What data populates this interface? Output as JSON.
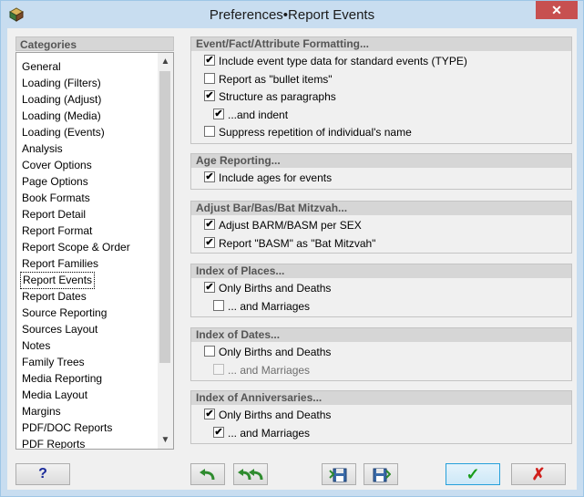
{
  "window": {
    "title": "Preferences•Report Events",
    "close_glyph": "✕"
  },
  "categories": {
    "header": "Categories",
    "items": [
      "General",
      "Loading (Filters)",
      "Loading (Adjust)",
      "Loading (Media)",
      "Loading (Events)",
      "Analysis",
      "Cover Options",
      "Page Options",
      "Book Formats",
      "Report Detail",
      "Report Format",
      "Report Scope & Order",
      "Report Families",
      "Report Events",
      "Report Dates",
      "Source Reporting",
      "Sources Layout",
      "Notes",
      "Family Trees",
      "Media Reporting",
      "Media Layout",
      "Margins",
      "PDF/DOC Reports",
      "PDF Reports"
    ],
    "selected": "Report Events",
    "scroll_up": "▲",
    "scroll_down": "▼"
  },
  "sections": {
    "formatting": {
      "header": "Event/Fact/Attribute Formatting...",
      "options": [
        {
          "label": "Include event type data for standard events (TYPE)",
          "checked": true
        },
        {
          "label": "Report as \"bullet items\"",
          "checked": false
        },
        {
          "label": "Structure as paragraphs",
          "checked": true
        },
        {
          "label": "...and indent",
          "checked": true
        },
        {
          "label": "Suppress repetition of individual's name",
          "checked": false
        }
      ]
    },
    "age": {
      "header": "Age Reporting...",
      "options": [
        {
          "label": "Include ages for events",
          "checked": true
        }
      ]
    },
    "mitzvah": {
      "header": "Adjust Bar/Bas/Bat Mitzvah...",
      "options": [
        {
          "label": "Adjust BARM/BASM per SEX",
          "checked": true
        },
        {
          "label": "Report \"BASM\" as \"Bat Mitzvah\"",
          "checked": true
        }
      ]
    },
    "places": {
      "header": "Index of Places...",
      "options": [
        {
          "label": "Only Births and Deaths",
          "checked": true
        },
        {
          "label": "... and Marriages",
          "checked": false
        }
      ]
    },
    "dates": {
      "header": "Index of Dates...",
      "options": [
        {
          "label": "Only Births and Deaths",
          "checked": false
        },
        {
          "label": "... and Marriages",
          "checked": false,
          "disabled": true
        }
      ]
    },
    "anniversaries": {
      "header": "Index of Anniversaries...",
      "options": [
        {
          "label": "Only Births and Deaths",
          "checked": true
        },
        {
          "label": "... and Marriages",
          "checked": true
        }
      ]
    }
  },
  "buttons": {
    "help": "?",
    "ok": "✓",
    "cancel": "✗",
    "undo_icon": "undo-arrow-icon",
    "redo_icon": "undo-all-arrow-icon",
    "save_icon": "save-disk-icon",
    "load_icon": "load-disk-icon"
  },
  "colors": {
    "ok_green": "#1a9c1a",
    "cancel_red": "#d0201c",
    "help_blue": "#1a2a9a",
    "arrow_green": "#2e8b2e"
  }
}
